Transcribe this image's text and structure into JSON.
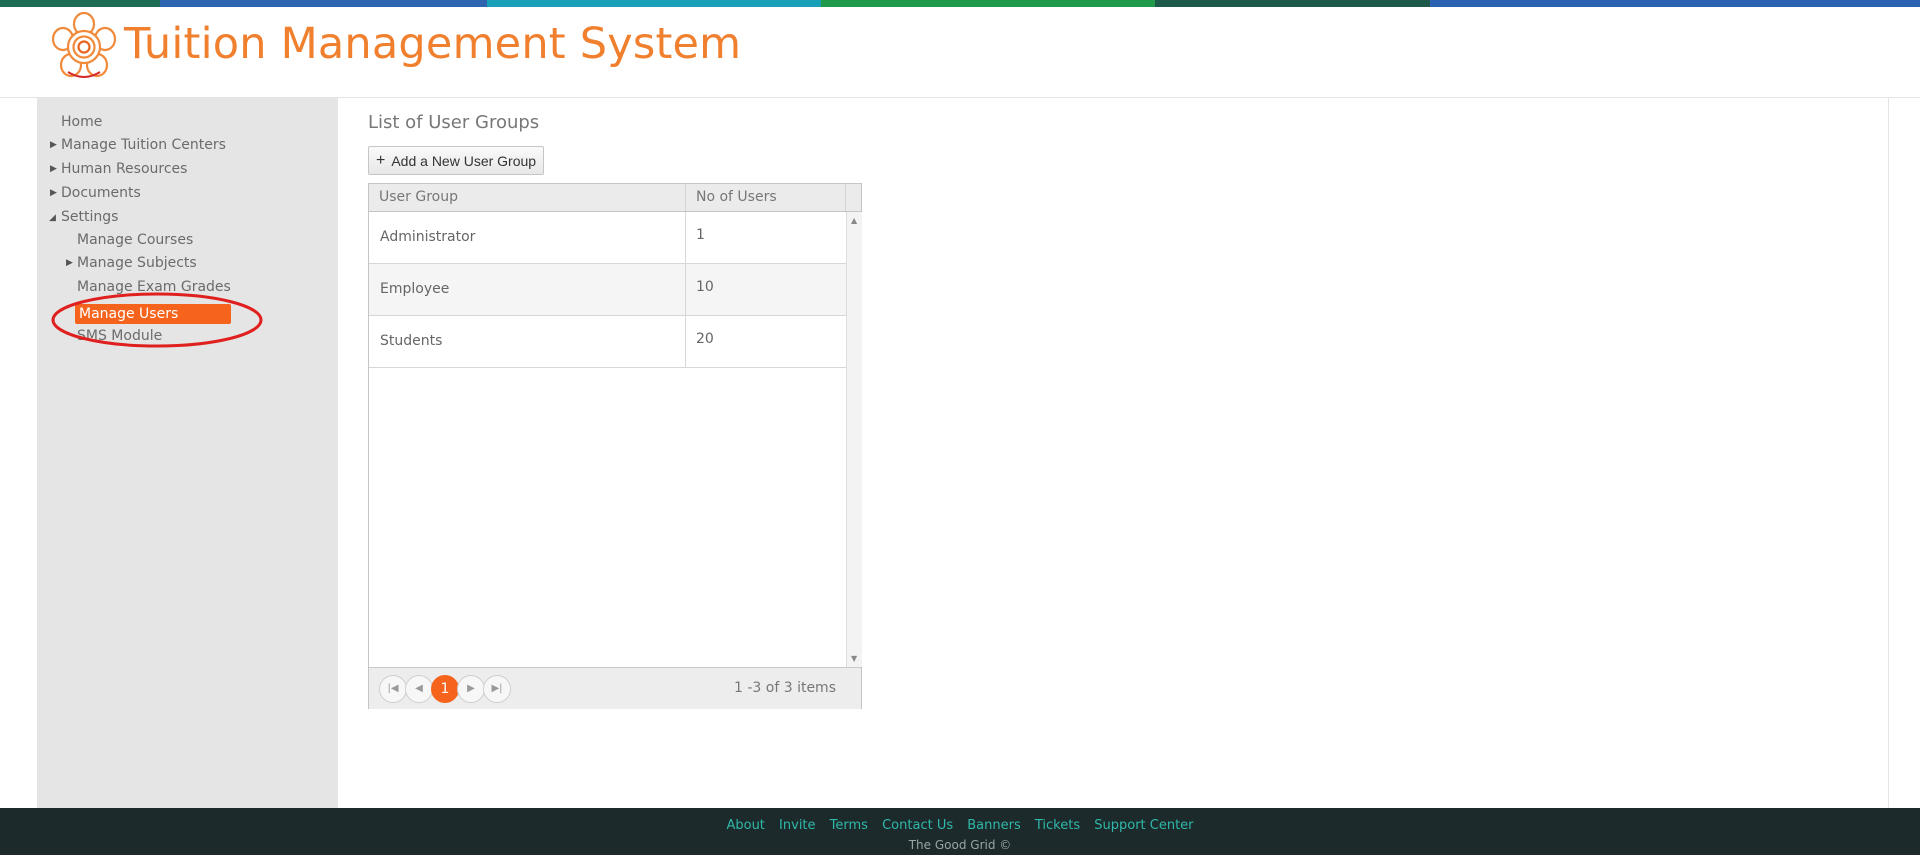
{
  "header": {
    "title": "Tuition Management System",
    "logo_icon": "flower-logo-icon"
  },
  "colors": {
    "brand_orange": "#f07f2e",
    "active_orange": "#f5631c",
    "sidebar_bg": "#e5e5e5",
    "footer_bg": "#1d2a2c",
    "footer_link": "#2fb8a8",
    "annotation_red": "#e0201f",
    "stripe": [
      "#1d7a4a",
      "#2e64b0",
      "#18a0b8",
      "#1f9a4a",
      "#1d5a4a",
      "#2d62b2"
    ]
  },
  "sidebar": {
    "items": [
      {
        "label": "Home",
        "level": 0,
        "caret": "",
        "active": false
      },
      {
        "label": "Manage Tuition Centers",
        "level": 0,
        "caret": "collapsed",
        "active": false
      },
      {
        "label": "Human Resources",
        "level": 0,
        "caret": "collapsed",
        "active": false
      },
      {
        "label": "Documents",
        "level": 0,
        "caret": "collapsed",
        "active": false
      },
      {
        "label": "Settings",
        "level": 0,
        "caret": "expanded",
        "active": false
      },
      {
        "label": "Manage Courses",
        "level": 1,
        "caret": "",
        "active": false
      },
      {
        "label": "Manage Subjects",
        "level": 1,
        "caret": "collapsed",
        "active": false
      },
      {
        "label": "Manage Exam Grades",
        "level": 1,
        "caret": "",
        "active": false
      },
      {
        "label": "Manage Users",
        "level": 1,
        "caret": "",
        "active": true
      },
      {
        "label": "SMS Module",
        "level": 1,
        "caret": "",
        "active": false
      }
    ]
  },
  "main": {
    "heading": "List of User Groups",
    "add_button_icon": "plus-icon",
    "add_button_label": "Add a New User Group",
    "table": {
      "columns": [
        "User Group",
        "No of Users"
      ],
      "rows": [
        [
          "Administrator",
          "1"
        ],
        [
          "Employee",
          "10"
        ],
        [
          "Students",
          "20"
        ]
      ]
    },
    "pager": {
      "first_icon": "first-page-icon",
      "prev_icon": "prev-page-icon",
      "current_page": "1",
      "next_icon": "next-page-icon",
      "last_icon": "last-page-icon",
      "info": "1 -3 of 3 items"
    }
  },
  "footer": {
    "links": [
      "About",
      "Invite",
      "Terms",
      "Contact Us",
      "Banners",
      "Tickets",
      "Support Center"
    ],
    "copyright": "The Good Grid ©"
  }
}
